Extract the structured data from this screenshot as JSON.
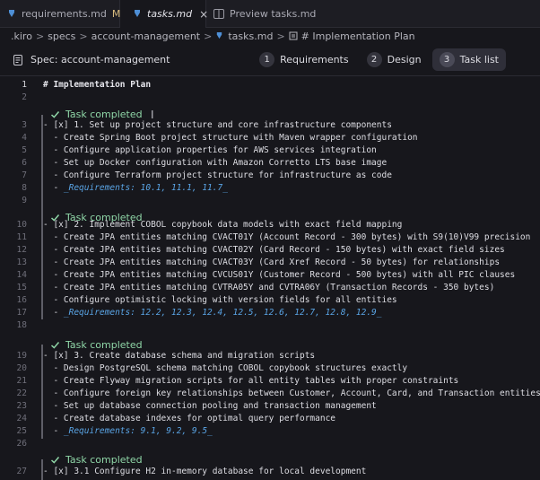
{
  "tabs": [
    {
      "label": "requirements.md",
      "modified": "M",
      "active": false
    },
    {
      "label": "tasks.md",
      "close": "×",
      "active": true
    },
    {
      "label": "Preview tasks.md",
      "active": false
    }
  ],
  "breadcrumb": {
    "items": [
      ".kiro",
      "specs",
      "account-management",
      "tasks.md",
      "# Implementation Plan"
    ],
    "separator": ">"
  },
  "spec": {
    "title": "Spec: account-management",
    "steps": [
      {
        "num": "1",
        "label": "Requirements"
      },
      {
        "num": "2",
        "label": "Design"
      },
      {
        "num": "3",
        "label": "Task list"
      }
    ],
    "active_step": "3"
  },
  "editor": {
    "codelens": "Task completed",
    "lines": [
      {
        "n": "1",
        "text": "# Implementation Plan"
      },
      {
        "n": "2",
        "text": ""
      },
      {
        "n": "3",
        "text": "- [x] 1. Set up project structure and core infrastructure components"
      },
      {
        "n": "4",
        "text": "  - Create Spring Boot project structure with Maven wrapper configuration"
      },
      {
        "n": "5",
        "text": "  - Configure application properties for AWS services integration"
      },
      {
        "n": "6",
        "text": "  - Set up Docker configuration with Amazon Corretto LTS base image"
      },
      {
        "n": "7",
        "text": "  - Configure Terraform project structure for infrastructure as code"
      },
      {
        "n": "8",
        "text": "  - _Requirements: 10.1, 11.1, 11.7_"
      },
      {
        "n": "9",
        "text": ""
      },
      {
        "n": "10",
        "text": "- [x] 2. Implement COBOL copybook data models with exact field mapping"
      },
      {
        "n": "11",
        "text": "  - Create JPA entities matching CVACT01Y (Account Record - 300 bytes) with S9(10)V99 precision"
      },
      {
        "n": "12",
        "text": "  - Create JPA entities matching CVACT02Y (Card Record - 150 bytes) with exact field sizes"
      },
      {
        "n": "13",
        "text": "  - Create JPA entities matching CVACT03Y (Card Xref Record - 50 bytes) for relationships"
      },
      {
        "n": "14",
        "text": "  - Create JPA entities matching CVCUS01Y (Customer Record - 500 bytes) with all PIC clauses"
      },
      {
        "n": "15",
        "text": "  - Create JPA entities matching CVTRA05Y and CVTRA06Y (Transaction Records - 350 bytes)"
      },
      {
        "n": "16",
        "text": "  - Configure optimistic locking with version fields for all entities"
      },
      {
        "n": "17",
        "text": "  - _Requirements: 12.2, 12.3, 12.4, 12.5, 12.6, 12.7, 12.8, 12.9_"
      },
      {
        "n": "18",
        "text": ""
      },
      {
        "n": "19",
        "text": "- [x] 3. Create database schema and migration scripts"
      },
      {
        "n": "20",
        "text": "  - Design PostgreSQL schema matching COBOL copybook structures exactly"
      },
      {
        "n": "21",
        "text": "  - Create Flyway migration scripts for all entity tables with proper constraints"
      },
      {
        "n": "22",
        "text": "  - Configure foreign key relationships between Customer, Account, Card, and Transaction entities"
      },
      {
        "n": "23",
        "text": "  - Set up database connection pooling and transaction management"
      },
      {
        "n": "24",
        "text": "  - Create database indexes for optimal query performance"
      },
      {
        "n": "25",
        "text": "  - _Requirements: 9.1, 9.2, 9.5_"
      },
      {
        "n": "26",
        "text": ""
      },
      {
        "n": "27",
        "text": "- [x] 3.1 Configure H2 in-memory database for local development"
      }
    ]
  },
  "colors": {
    "background": "#17171c",
    "task_completed": "#8fd6a7",
    "requirements_link": "#5aa5e6",
    "modified": "#d7ba7d"
  }
}
